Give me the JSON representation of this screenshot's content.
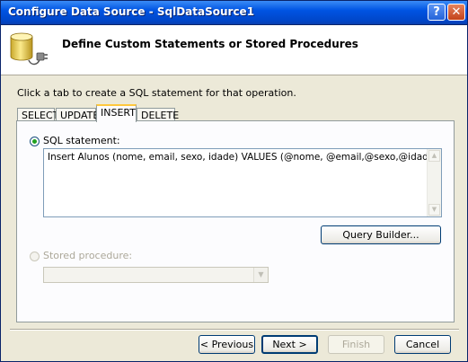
{
  "window": {
    "title": "Configure Data Source - SqlDataSource1",
    "help_label": "?",
    "close_label": "✕"
  },
  "header": {
    "icon": "database-plug-icon",
    "title": "Define Custom Statements or Stored Procedures"
  },
  "instructions": "Click a tab to create a SQL statement for that operation.",
  "tabs": [
    {
      "label": "SELECT",
      "selected": false
    },
    {
      "label": "UPDATE",
      "selected": false
    },
    {
      "label": "INSERT",
      "selected": true
    },
    {
      "label": "DELETE",
      "selected": false
    }
  ],
  "sql_statement": {
    "label": "SQL statement:",
    "selected": true,
    "value": "Insert Alunos (nome, email, sexo, idade) VALUES (@nome, @email,@sexo,@idade)"
  },
  "query_builder_label": "Query Builder...",
  "stored_procedure": {
    "label": "Stored procedure:",
    "selected": false,
    "enabled": false,
    "value": ""
  },
  "footer": {
    "previous_label": "< Previous",
    "next_label": "Next >",
    "finish_label": "Finish",
    "cancel_label": "Cancel",
    "finish_enabled": false
  },
  "colors": {
    "titlebar": "#0054E3",
    "dialog_background": "#ECE9D8",
    "active_tab_accent": "#FFC83C",
    "radio_selected": "#21A121"
  }
}
